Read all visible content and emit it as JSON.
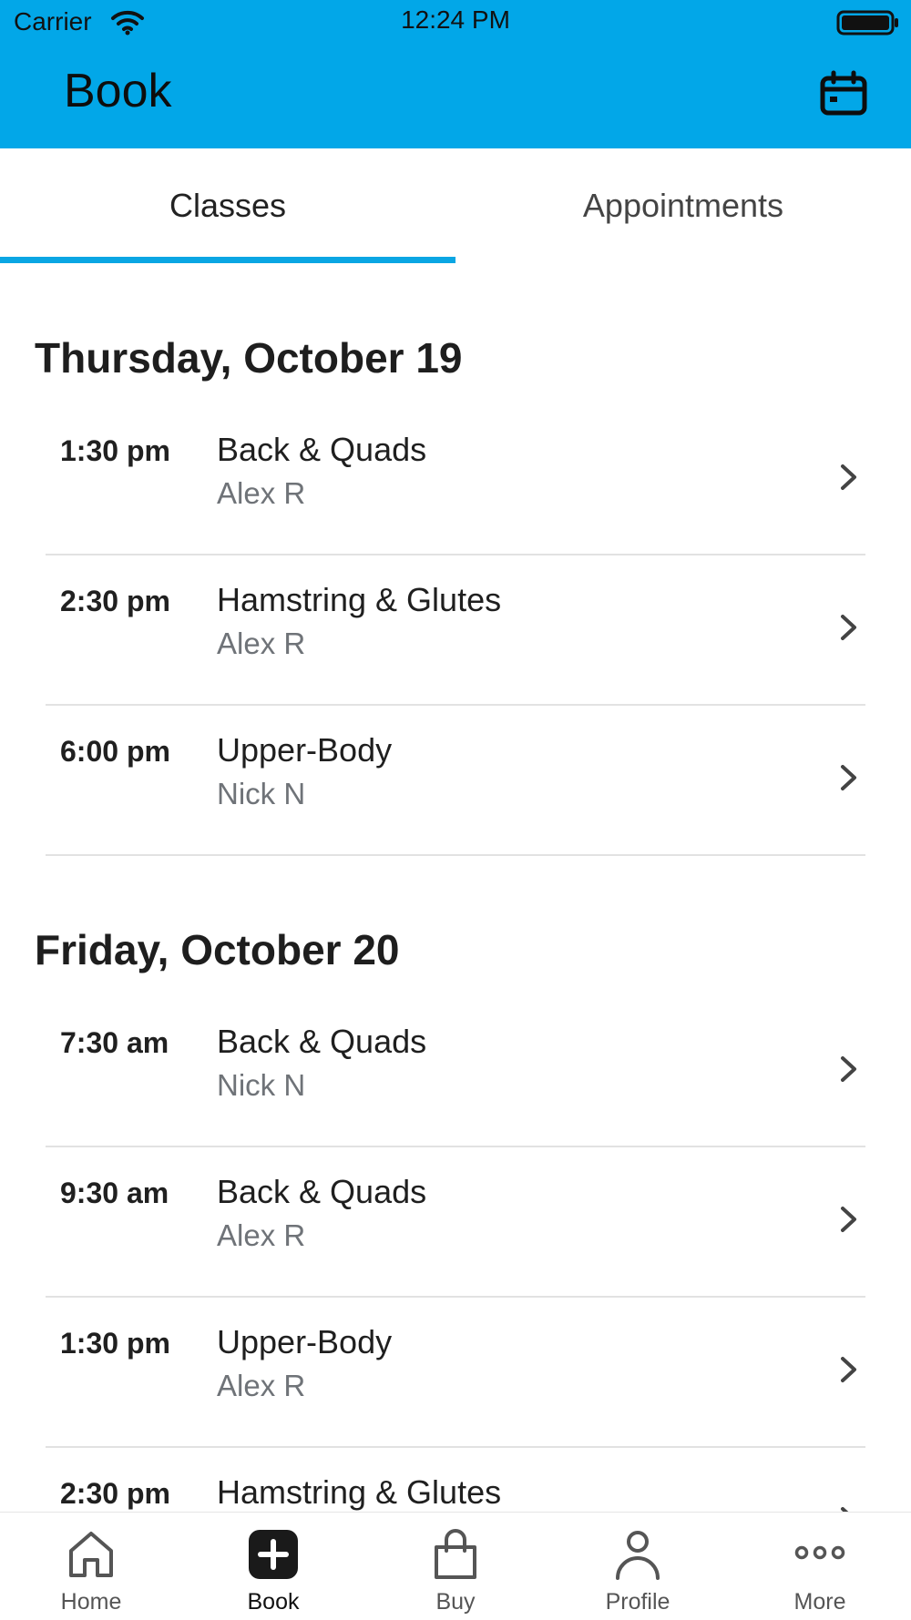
{
  "status_bar": {
    "carrier": "Carrier",
    "time": "12:24 PM"
  },
  "header": {
    "title": "Book",
    "background_color": "#02A7E8"
  },
  "tabs": {
    "classes": "Classes",
    "appointments": "Appointments",
    "active": "Classes"
  },
  "days": [
    {
      "heading": "Thursday, October 19",
      "classes": [
        {
          "time": "1:30 pm",
          "name": "Back & Quads",
          "instructor": "Alex R"
        },
        {
          "time": "2:30 pm",
          "name": "Hamstring & Glutes",
          "instructor": "Alex R"
        },
        {
          "time": "6:00 pm",
          "name": "Upper-Body",
          "instructor": "Nick N"
        }
      ]
    },
    {
      "heading": "Friday, October 20",
      "classes": [
        {
          "time": "7:30 am",
          "name": "Back & Quads",
          "instructor": "Nick N"
        },
        {
          "time": "9:30 am",
          "name": "Back & Quads",
          "instructor": "Alex R"
        },
        {
          "time": "1:30 pm",
          "name": "Upper-Body",
          "instructor": "Alex R"
        },
        {
          "time": "2:30 pm",
          "name": "Hamstring & Glutes",
          "instructor": ""
        }
      ]
    }
  ],
  "tab_bar": {
    "items": [
      {
        "label": "Home",
        "icon": "home-icon"
      },
      {
        "label": "Book",
        "icon": "plus-square-icon"
      },
      {
        "label": "Buy",
        "icon": "shopping-bag-icon"
      },
      {
        "label": "Profile",
        "icon": "person-icon"
      },
      {
        "label": "More",
        "icon": "more-dots-icon"
      }
    ],
    "active": "Book"
  }
}
